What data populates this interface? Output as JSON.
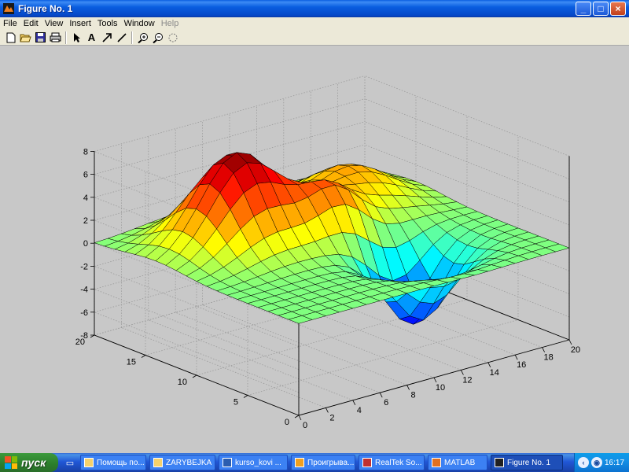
{
  "window": {
    "title": "Figure No. 1",
    "controls": {
      "minimize": "_",
      "maximize": "□",
      "close": "×"
    }
  },
  "menu": {
    "items": [
      "File",
      "Edit",
      "View",
      "Insert",
      "Tools",
      "Window",
      "Help"
    ]
  },
  "toolbar": {
    "tools": [
      "new-icon",
      "open-icon",
      "save-icon",
      "print-icon",
      "pointer-icon",
      "text-icon",
      "arrow-icon",
      "line-icon",
      "zoom-in-icon",
      "zoom-out-icon",
      "rotate-icon"
    ],
    "text_tool_label": "A"
  },
  "chart_data": {
    "type": "surface",
    "title": "",
    "colormap": "jet",
    "grid": true,
    "x_ticks": [
      0,
      2,
      4,
      6,
      8,
      10,
      12,
      14,
      16,
      18,
      20
    ],
    "y_ticks": [
      0,
      5,
      10,
      15,
      20
    ],
    "z_ticks": [
      -8,
      -6,
      -4,
      -2,
      0,
      2,
      4,
      6,
      8
    ],
    "xlim": [
      0,
      20
    ],
    "ylim": [
      0,
      20
    ],
    "zlim": [
      -8,
      8
    ],
    "grid_size": 20,
    "peaks": [
      {
        "x": 6,
        "y": 14,
        "amplitude": 8.0,
        "width": 2.6
      },
      {
        "x": 11,
        "y": 11,
        "amplitude": 3.8,
        "width": 1.8
      },
      {
        "x": 15,
        "y": 15,
        "amplitude": 3.5,
        "width": 2.6
      },
      {
        "x": 13,
        "y": 6,
        "amplitude": -6.5,
        "width": 2.0
      }
    ]
  },
  "taskbar": {
    "start_label": "пуск",
    "tasks": [
      {
        "label": "Помощь по...",
        "icon": "folder-icon"
      },
      {
        "label": "ZARYBEJKA",
        "icon": "folder-icon"
      },
      {
        "label": "kurso_kovi ...",
        "icon": "word-icon"
      },
      {
        "label": "Проигрыва...",
        "icon": "media-player-icon"
      },
      {
        "label": "RealTek So...",
        "icon": "audio-icon"
      },
      {
        "label": "MATLAB",
        "icon": "matlab-icon"
      },
      {
        "label": "Figure No. 1",
        "icon": "matlab-figure-icon",
        "active": true
      }
    ],
    "clock": "16:17"
  }
}
